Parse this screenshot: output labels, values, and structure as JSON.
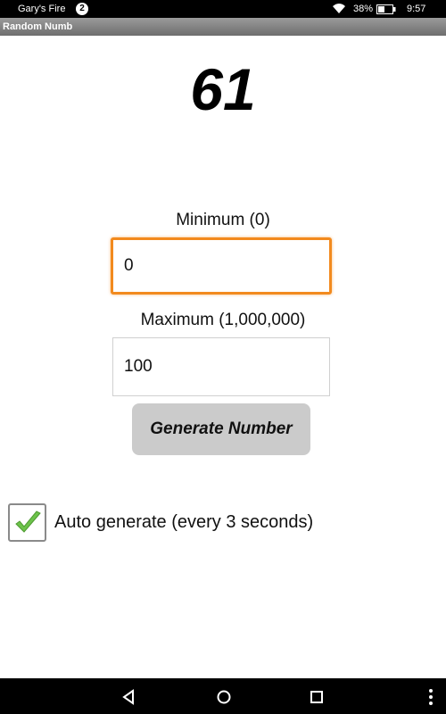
{
  "status_bar": {
    "device_name": "Gary's Fire",
    "notification_count": "2",
    "battery": "38%",
    "time": "9:57",
    "icons": [
      "wifi-icon",
      "battery-icon"
    ]
  },
  "app": {
    "title": "Random Numb"
  },
  "result": {
    "value": "61"
  },
  "minimum": {
    "label": "Minimum (0)",
    "value": "0"
  },
  "maximum": {
    "label": "Maximum (1,000,000)",
    "value": "100"
  },
  "generate_button": {
    "label": "Generate Number"
  },
  "auto_generate": {
    "label": "Auto generate (every 3 seconds)",
    "checked": true
  },
  "nav_bar": {
    "icons": [
      "back-icon",
      "home-icon",
      "recents-icon",
      "overflow-menu-icon"
    ]
  },
  "colors": {
    "focus_border": "#f28a1e",
    "check_green": "#6cc24a",
    "button_bg": "#cbcbcb"
  }
}
